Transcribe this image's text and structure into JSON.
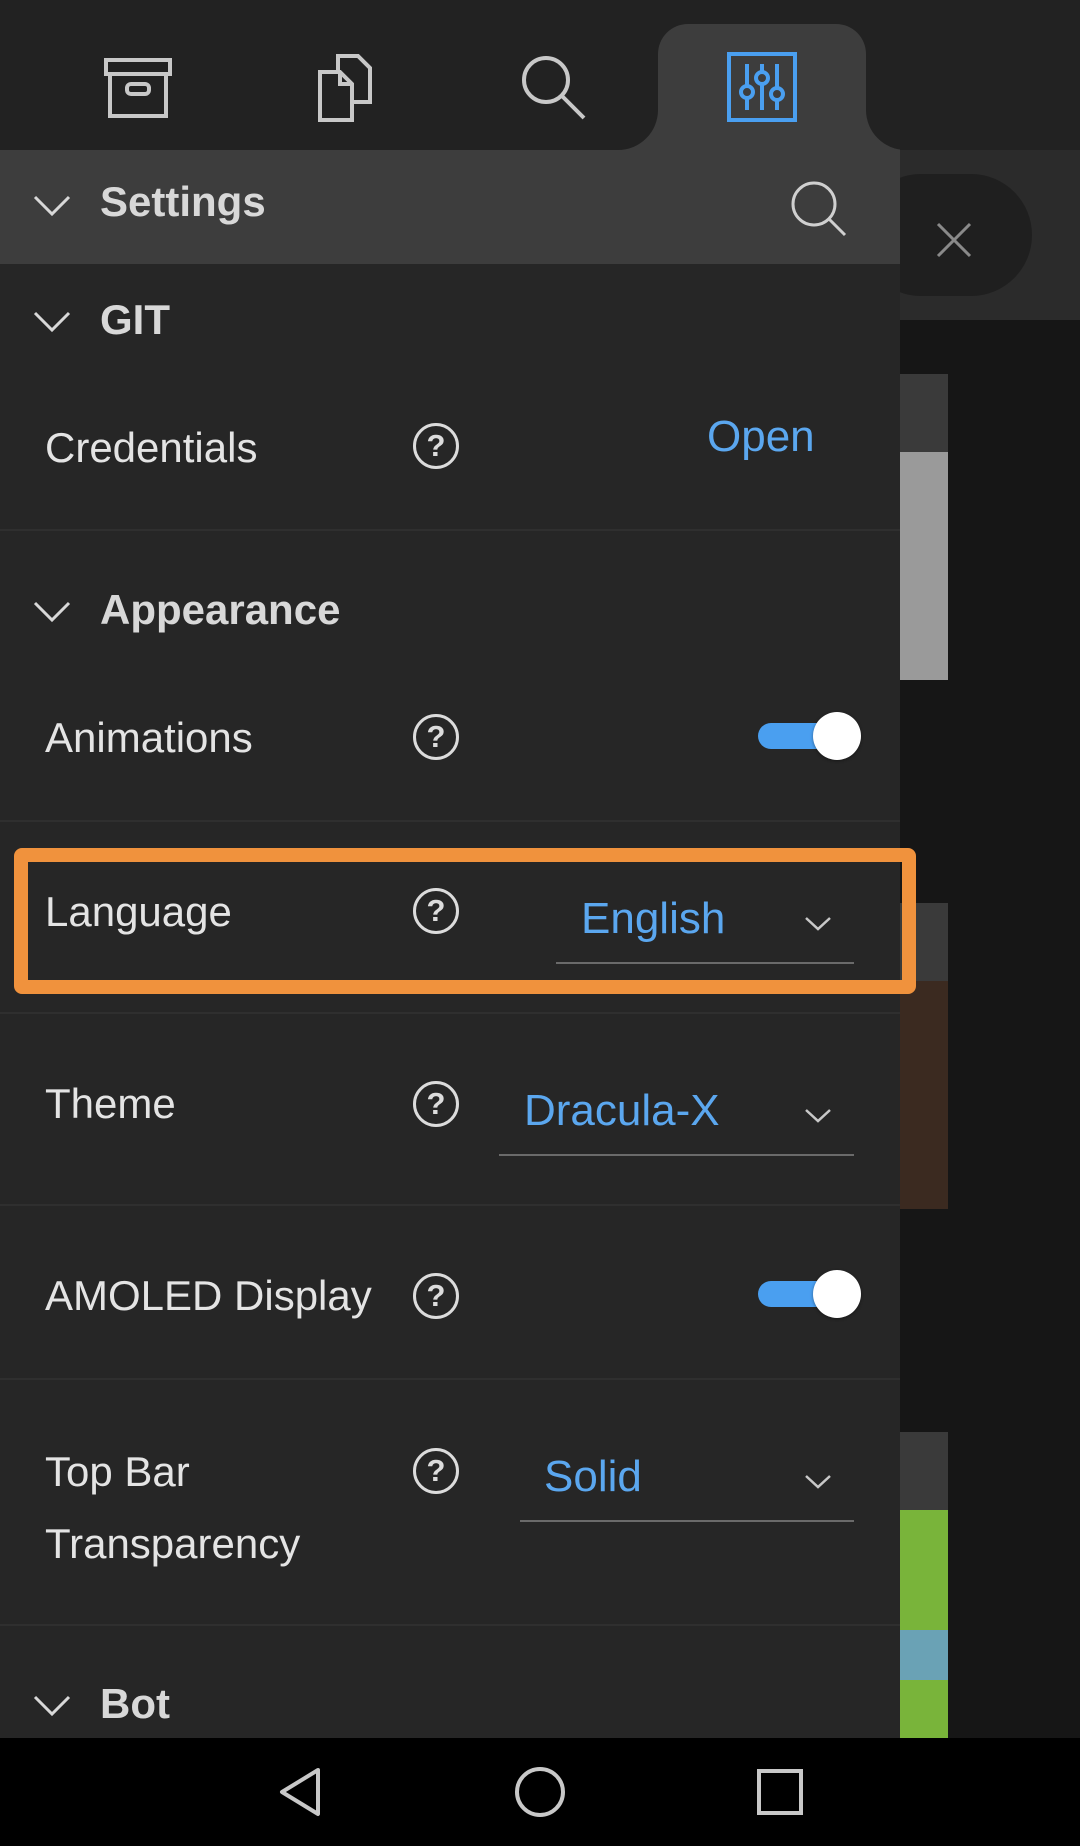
{
  "settings": {
    "title": "Settings"
  },
  "sections": {
    "git": {
      "title": "GIT",
      "credentials_label": "Credentials",
      "credentials_action": "Open"
    },
    "appearance": {
      "title": "Appearance",
      "animations_label": "Animations",
      "animations_on": true,
      "language_label": "Language",
      "language_value": "English",
      "theme_label": "Theme",
      "theme_value": "Dracula-X",
      "amoled_label": "AMOLED Display",
      "amoled_on": true,
      "topbar_label_line1": "Top Bar",
      "topbar_label_line2": "Transparency",
      "topbar_value": "Solid"
    },
    "bot": {
      "title": "Bot"
    }
  },
  "tabs": [
    "archive-icon",
    "files-icon",
    "search-icon",
    "settings-sliders-icon"
  ],
  "help_glyph": "?",
  "colors": {
    "accent": "#5ba7ef",
    "toggle": "#4a9ff0",
    "highlight": "#f0923d"
  }
}
